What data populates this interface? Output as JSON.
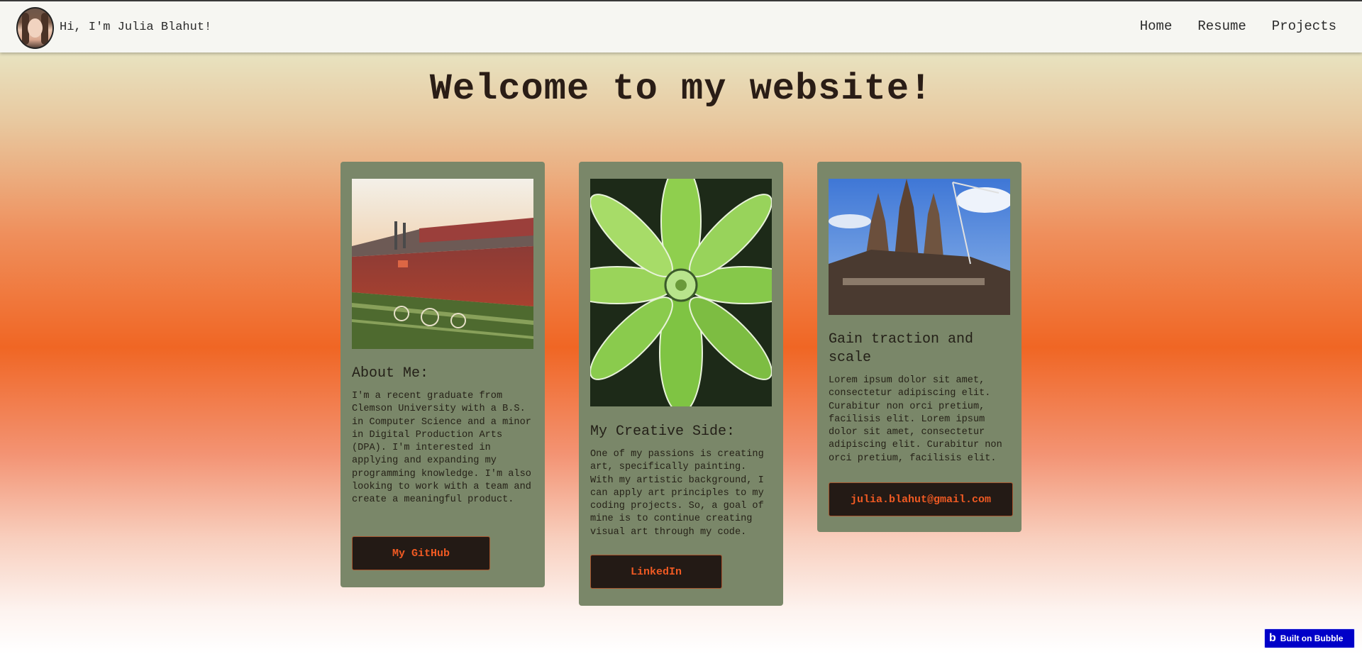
{
  "navbar": {
    "greeting": "Hi, I'm Julia Blahut!",
    "links": [
      "Home",
      "Resume",
      "Projects"
    ]
  },
  "page": {
    "title": "Welcome to my website!"
  },
  "cards": [
    {
      "image": "stadium-crowd-photo",
      "heading": "About Me:",
      "text": "I'm a recent graduate from Clemson University with a B.S. in Computer Science and a minor in Digital Production Arts (DPA). I'm interested in applying and expanding my programming knowledge. I'm also looking to work with a team and create a meaningful product.",
      "button": "My GitHub"
    },
    {
      "image": "green-succulent-painting",
      "heading": "My Creative Side:",
      "text": "One of my passions is creating art, specifically painting. With my artistic background, I can apply art principles to my coding projects. So, a goal of mine is to continue creating visual art through my code.",
      "button": "LinkedIn"
    },
    {
      "image": "cathedral-photo",
      "heading": "Gain traction and scale",
      "text": "Lorem ipsum dolor sit amet, consectetur adipiscing elit. Curabitur non orci pretium, facilisis elit. Lorem ipsum dolor sit amet, consectetur adipiscing elit. Curabitur non orci pretium, facilisis elit.",
      "button": "julia.blahut@gmail.com"
    }
  ],
  "badge": {
    "icon": "bubble-logo-icon",
    "label": "Built on Bubble"
  },
  "colors": {
    "card_bg": "#7a8769",
    "button_bg": "#231a15",
    "button_text": "#f05a23",
    "badge_bg": "#0000c8"
  }
}
